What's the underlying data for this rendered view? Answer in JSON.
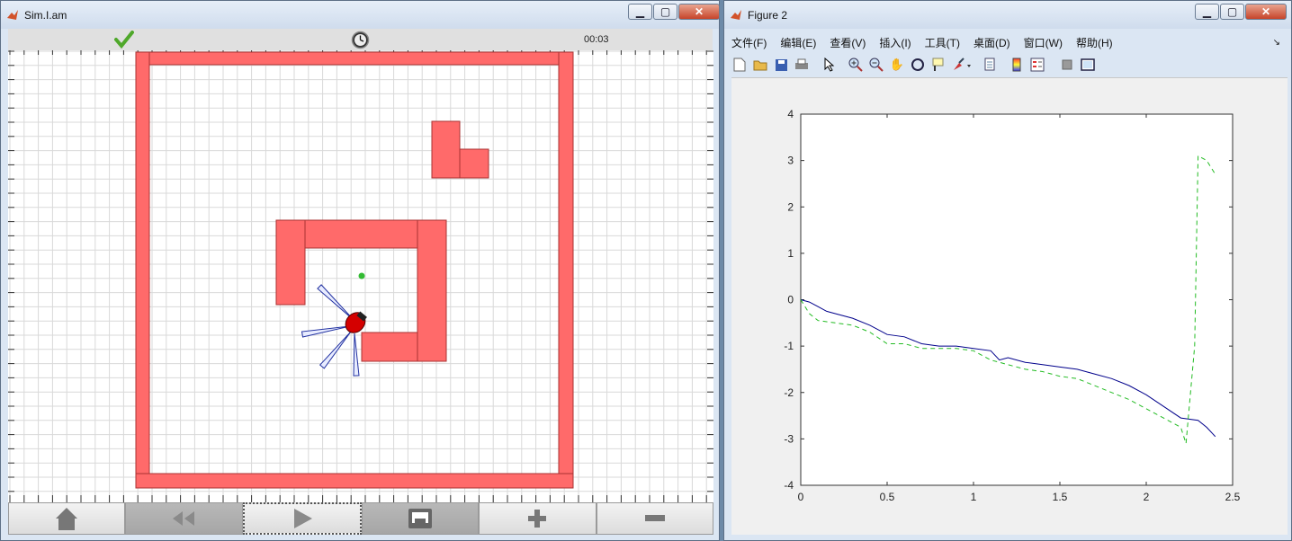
{
  "sim_window": {
    "title": "Sim.I.am",
    "status_icon": "check-icon",
    "clock_icon": "clock-icon",
    "timer": "00:03",
    "toolbar": {
      "home_icon": "home-icon",
      "rewind_icon": "rewind-icon",
      "play_icon": "play-icon",
      "network_icon": "network-icon",
      "zoom_in_icon": "plus-icon",
      "zoom_out_icon": "minus-icon"
    },
    "colors": {
      "wall": "#ff6a6a",
      "robot": "#d40000",
      "sensor": "#2030a0",
      "goal": "#33bb33"
    }
  },
  "figure_window": {
    "title": "Figure 2",
    "menu": [
      "文件(F)",
      "编辑(E)",
      "查看(V)",
      "插入(I)",
      "工具(T)",
      "桌面(D)",
      "窗口(W)",
      "帮助(H)"
    ],
    "toolbar_icons": [
      "new-icon",
      "open-icon",
      "save-icon",
      "print-icon",
      "pointer-icon",
      "zoom-in-icon",
      "zoom-out-icon",
      "pan-icon",
      "rotate-icon",
      "datacursor-icon",
      "brush-icon",
      "link-icon",
      "colorbar-icon",
      "legend-icon",
      "hide-plottools-icon",
      "show-plottools-icon"
    ]
  },
  "chart_data": {
    "type": "line",
    "title": "",
    "xlabel": "",
    "ylabel": "",
    "xlim": [
      0,
      2.5
    ],
    "ylim": [
      -4,
      4
    ],
    "xticks": [
      "0",
      "0.5",
      "1",
      "1.5",
      "2",
      "2.5"
    ],
    "yticks": [
      "4",
      "3",
      "2",
      "1",
      "0",
      "-1",
      "-2",
      "-3",
      "-4"
    ],
    "series": [
      {
        "color": "#00008b",
        "style": "solid",
        "x": [
          0,
          0.05,
          0.1,
          0.15,
          0.2,
          0.3,
          0.4,
          0.5,
          0.6,
          0.7,
          0.8,
          0.9,
          1.0,
          1.1,
          1.15,
          1.2,
          1.3,
          1.4,
          1.5,
          1.6,
          1.7,
          1.8,
          1.9,
          2.0,
          2.1,
          2.2,
          2.3,
          2.35,
          2.4
        ],
        "y": [
          0,
          -0.05,
          -0.15,
          -0.25,
          -0.3,
          -0.4,
          -0.55,
          -0.75,
          -0.8,
          -0.95,
          -1.0,
          -1.0,
          -1.05,
          -1.1,
          -1.3,
          -1.25,
          -1.35,
          -1.4,
          -1.45,
          -1.5,
          -1.6,
          -1.7,
          -1.85,
          -2.05,
          -2.3,
          -2.55,
          -2.6,
          -2.75,
          -2.95
        ]
      },
      {
        "color": "#22bb22",
        "style": "dashed",
        "x": [
          0,
          0.05,
          0.1,
          0.2,
          0.3,
          0.4,
          0.5,
          0.6,
          0.7,
          0.8,
          0.9,
          1.0,
          1.1,
          1.2,
          1.3,
          1.4,
          1.5,
          1.6,
          1.7,
          1.8,
          1.9,
          2.0,
          2.1,
          2.2,
          2.23,
          2.28,
          2.3,
          2.35,
          2.4
        ],
        "y": [
          0,
          -0.3,
          -0.45,
          -0.5,
          -0.55,
          -0.7,
          -0.95,
          -0.95,
          -1.05,
          -1.05,
          -1.05,
          -1.1,
          -1.3,
          -1.4,
          -1.5,
          -1.55,
          -1.65,
          -1.7,
          -1.85,
          -2.0,
          -2.15,
          -2.35,
          -2.55,
          -2.75,
          -3.1,
          -1.0,
          3.1,
          3.0,
          2.7
        ]
      }
    ]
  }
}
